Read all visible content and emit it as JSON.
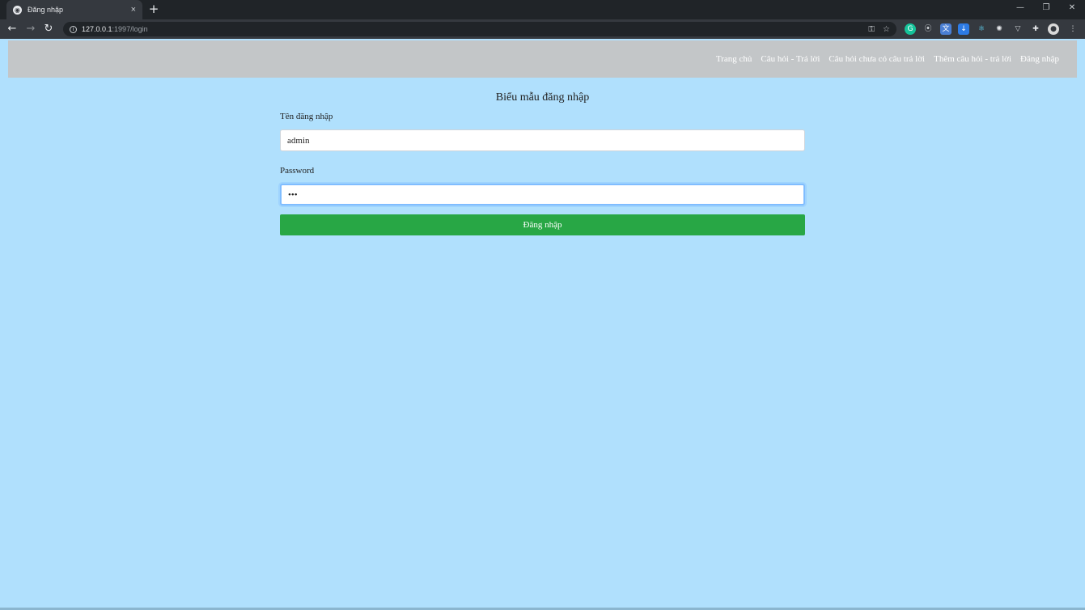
{
  "browser": {
    "tab_title": "Đăng nhập",
    "tab_close": "×",
    "new_tab": "+",
    "url_host": "127.0.0.1",
    "url_path": ":1997/login",
    "window_controls": {
      "minimize": "—",
      "restore": "❐",
      "close": "✕"
    }
  },
  "navbar": {
    "items": [
      {
        "label": "Trang chủ"
      },
      {
        "label": "Câu hỏi - Trả lời"
      },
      {
        "label": "Câu hỏi chưa có câu trả lời"
      },
      {
        "label": "Thêm câu hỏi - trả lời"
      },
      {
        "label": "Đăng nhập"
      }
    ]
  },
  "form": {
    "title": "Biểu mẫu đăng nhập",
    "username_label": "Tên đăng nhập",
    "username_value": "admin",
    "password_label": "Password",
    "password_value": "•••",
    "submit_label": "Đăng nhập"
  },
  "colors": {
    "page_bg": "#b0e0fd",
    "navbar_bg": "#c3c6c8",
    "submit_bg": "#28a745"
  }
}
